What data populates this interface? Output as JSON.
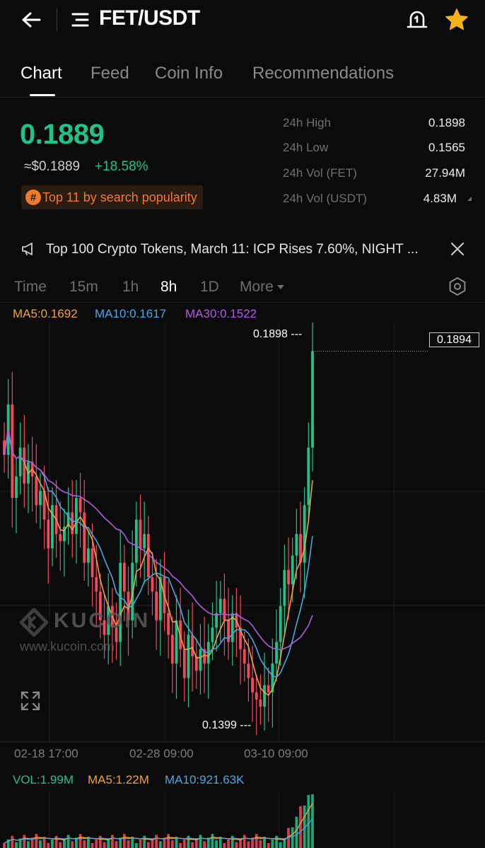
{
  "header": {
    "pair": "FET/USDT",
    "icons": [
      "back-arrow-icon",
      "menu-icon",
      "price-alert-icon",
      "star-icon"
    ],
    "star_color": "#f5b21b"
  },
  "tabs": [
    "Chart",
    "Feed",
    "Coin Info",
    "Recommendations"
  ],
  "active_tab": "Chart",
  "ticker": {
    "price": "0.1889",
    "usd_price": "≈$0.1889",
    "change": "+18.58%",
    "popularity_badge": "Top 11 by search popularity",
    "up_color": "#1fc38a",
    "down_color": "#f2495e",
    "accent_color": "#f07a2b"
  },
  "stats": [
    {
      "label": "24h High",
      "value": "0.1898"
    },
    {
      "label": "24h Low",
      "value": "0.1565"
    },
    {
      "label": "24h Vol (FET)",
      "value": "27.94M"
    },
    {
      "label": "24h Vol (USDT)",
      "value": "4.83M"
    }
  ],
  "news": {
    "text": "Top 100 Crypto Tokens, March 11: ICP Rises 7.60%, NIGHT ..."
  },
  "intervals": [
    "Time",
    "15m",
    "1h",
    "8h",
    "1D",
    "More"
  ],
  "active_interval": "8h",
  "ma_legend": {
    "ma5": "MA5:0.1692",
    "ma10": "MA10:0.1617",
    "ma30": "MA30:0.1522",
    "ma5_color": "#f0a23b",
    "ma10_color": "#4aa8e0",
    "ma30_color": "#b05de0"
  },
  "chart_data": {
    "type": "candlestick",
    "interval": "8h",
    "x_tick_labels": [
      "02-18 17:00",
      "02-28 09:00",
      "03-10 09:00"
    ],
    "visible_high_marker": "0.1898 ---",
    "visible_low_marker": "0.1399 ---",
    "last_price_tag": "0.1894",
    "approx_price_range": [
      0.136,
      0.192
    ],
    "candles_close_approx": [
      0.175,
      0.182,
      0.169,
      0.172,
      0.176,
      0.171,
      0.174,
      0.172,
      0.168,
      0.17,
      0.166,
      0.162,
      0.168,
      0.164,
      0.163,
      0.165,
      0.167,
      0.164,
      0.169,
      0.167,
      0.16,
      0.162,
      0.158,
      0.156,
      0.152,
      0.15,
      0.154,
      0.151,
      0.149,
      0.16,
      0.156,
      0.152,
      0.16,
      0.166,
      0.162,
      0.164,
      0.158,
      0.156,
      0.152,
      0.158,
      0.153,
      0.15,
      0.146,
      0.152,
      0.148,
      0.144,
      0.15,
      0.147,
      0.145,
      0.148,
      0.146,
      0.149,
      0.151,
      0.153,
      0.155,
      0.152,
      0.149,
      0.153,
      0.151,
      0.148,
      0.146,
      0.144,
      0.142,
      0.141,
      0.14,
      0.143,
      0.142,
      0.146,
      0.149,
      0.154,
      0.159,
      0.157,
      0.161,
      0.164,
      0.16,
      0.168,
      0.176,
      0.1894
    ],
    "volume_legend": {
      "vol": "VOL:1.99M",
      "ma5": "MA5:1.22M",
      "ma10": "MA10:921.63K"
    }
  },
  "watermark": {
    "brand": "KUCOIN",
    "url": "www.kucoin.com"
  }
}
